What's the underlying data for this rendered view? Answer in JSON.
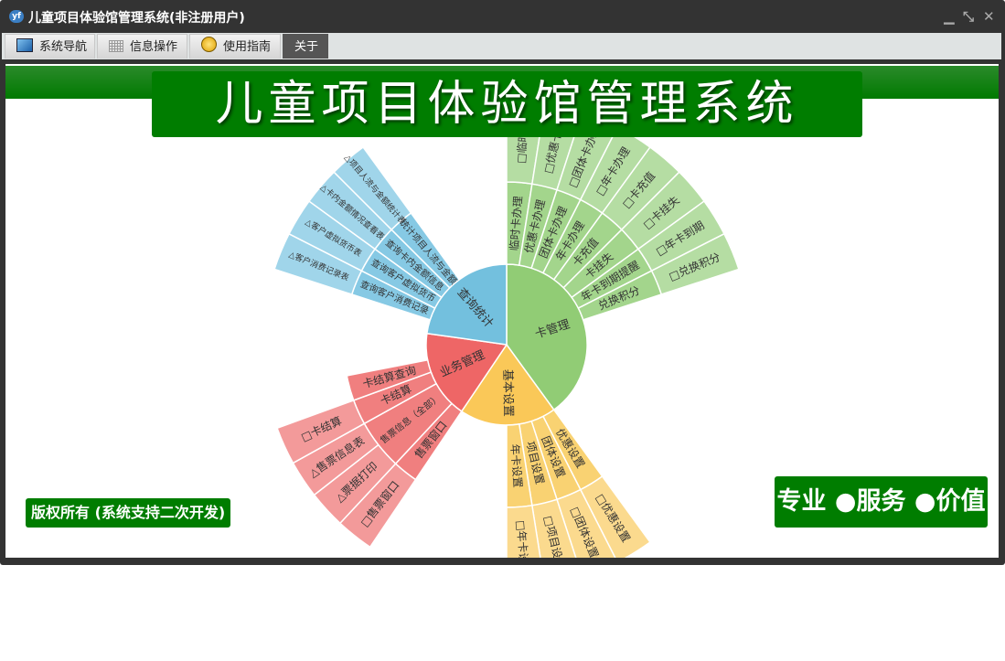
{
  "window": {
    "title": "儿童项目体验馆管理系统(非注册用户)",
    "app_icon": "yf-logo-icon"
  },
  "tabs": [
    {
      "label": "系统导航",
      "icon": "monitor-icon"
    },
    {
      "label": "信息操作",
      "icon": "grid-icon"
    },
    {
      "label": "使用指南",
      "icon": "help-icon"
    },
    {
      "label": "关于",
      "icon": "",
      "active": true
    }
  ],
  "banner": {
    "title": "儿童项目体验馆管理系统"
  },
  "footer": {
    "copyright": "版权所有 (系统支持二次开发)",
    "slogan": "专业 ●服务 ●价值"
  },
  "colors": {
    "green": [
      "#91cc75",
      "#a3d58c",
      "#b5dda3"
    ],
    "yellow": [
      "#fac858",
      "#f9d272",
      "#fbda8e"
    ],
    "red": [
      "#ee6666",
      "#f07f7f",
      "#f39a9a"
    ],
    "blue": [
      "#73c0de",
      "#86c9e4",
      "#a0d5ea"
    ],
    "brand": "#007d00"
  },
  "chart_data": {
    "type": "sunburst",
    "leaf_angle_deg": 9,
    "nodes": [
      {
        "name": "卡管理",
        "color": "green",
        "start": 0,
        "end": 144,
        "children": [
          {
            "name": "临时卡办理",
            "child": "□临时卡"
          },
          {
            "name": "优惠卡办理",
            "child": "□优惠卡办"
          },
          {
            "name": "团体卡办理",
            "child": "□团体卡办理"
          },
          {
            "name": "年卡办理",
            "child": "□年卡办理"
          },
          {
            "name": "卡充值",
            "child": "□卡充值"
          },
          {
            "name": "卡挂失",
            "child": "□卡挂失"
          },
          {
            "name": "年卡到期提醒",
            "child": "□年卡到期"
          },
          {
            "name": "兑换积分",
            "child": "□兑换积分"
          }
        ]
      },
      {
        "name": "基本设置",
        "color": "yellow",
        "start": 144,
        "end": 214,
        "children": [
          {
            "name": "优惠设置",
            "child": "□优惠设置"
          },
          {
            "name": "团体设置",
            "child": "□团体设置"
          },
          {
            "name": "项目设置",
            "child": "□项目设置"
          },
          {
            "name": "年卡设置",
            "child": "□年卡设置"
          }
        ]
      },
      {
        "name": "业务管理",
        "color": "red",
        "start": 214,
        "end": 278,
        "children": [
          {
            "name": "售票窗口",
            "children": [
              "□售票窗口"
            ]
          },
          {
            "name": "售票信息（全部）",
            "children": [
              "△票据打印",
              "△售票信息表"
            ]
          },
          {
            "name": "卡结算",
            "children": [
              "□卡结算"
            ]
          },
          {
            "name": "卡结算查询",
            "children": []
          }
        ]
      },
      {
        "name": "查询统计",
        "color": "blue",
        "start": 278,
        "end": 360,
        "offset": 10,
        "children": [
          {
            "name": "查询客户消费记录",
            "child": "△客户消费记录表"
          },
          {
            "name": "查询客户虚拟货币",
            "child": "△客户虚拟货币表"
          },
          {
            "name": "查询卡内金额信息",
            "child": "△卡内金额情况查看表"
          },
          {
            "name": "统计项目人流与金额",
            "child": "△项目人流与金额统计表"
          }
        ]
      }
    ]
  }
}
